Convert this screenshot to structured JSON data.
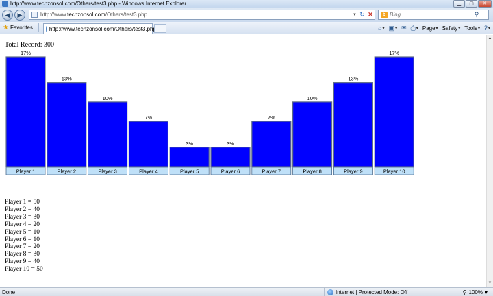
{
  "window": {
    "title": "http://www.techzonsol.com/Others/test3.php - Windows Internet Explorer",
    "minimize_glyph": "▁",
    "maximize_glyph": "▢",
    "close_glyph": "✕"
  },
  "navigation": {
    "back_glyph": "◀",
    "forward_glyph": "▶",
    "url_prefix": "http://www.",
    "url_domain": "techzonsol.com",
    "url_path": "/Others/test3.php",
    "dropdown_glyph": "▼",
    "refresh_glyph": "↻",
    "stop_glyph": "✕",
    "search_placeholder": "Bing",
    "search_logo": "b",
    "search_glyph": "⚲"
  },
  "favorites_bar": {
    "favorites_label": "Favorites",
    "tab_title": "http://www.techzonsol.com/Others/test3.php"
  },
  "command_bar": {
    "home_glyph": "⌂",
    "feeds_glyph": "▣",
    "mail_glyph": "✉",
    "print_glyph": "⎙",
    "page_label": "Page",
    "safety_label": "Safety",
    "tools_label": "Tools",
    "help_glyph": "?",
    "dd_glyph": "▾"
  },
  "page": {
    "total_label": "Total Record: 300",
    "list": [
      "Player 1 = 50",
      "Player 2 = 40",
      "Player 3 = 30",
      "Player 4 = 20",
      "Player 5 = 10",
      "Player 6 = 10",
      "Player 7 = 20",
      "Player 8 = 30",
      "Player 9 = 40",
      "Player 10 = 50"
    ]
  },
  "chart_data": {
    "type": "bar",
    "categories": [
      "Player 1",
      "Player 2",
      "Player 3",
      "Player 4",
      "Player 5",
      "Player 6",
      "Player 7",
      "Player 8",
      "Player 9",
      "Player 10"
    ],
    "values": [
      17,
      13,
      10,
      7,
      3,
      3,
      7,
      10,
      13,
      17
    ],
    "data_labels": [
      "17%",
      "13%",
      "10%",
      "7%",
      "3%",
      "3%",
      "7%",
      "10%",
      "13%",
      "17%"
    ],
    "title": "",
    "xlabel": "",
    "ylabel": "",
    "ylim": [
      0,
      17
    ],
    "grid": false,
    "bar_color": "#0000ff",
    "label_box_color": "#bfe0f8"
  },
  "status": {
    "left": "Done",
    "zone": "Internet | Protected Mode: Off",
    "zoom": "100%"
  }
}
